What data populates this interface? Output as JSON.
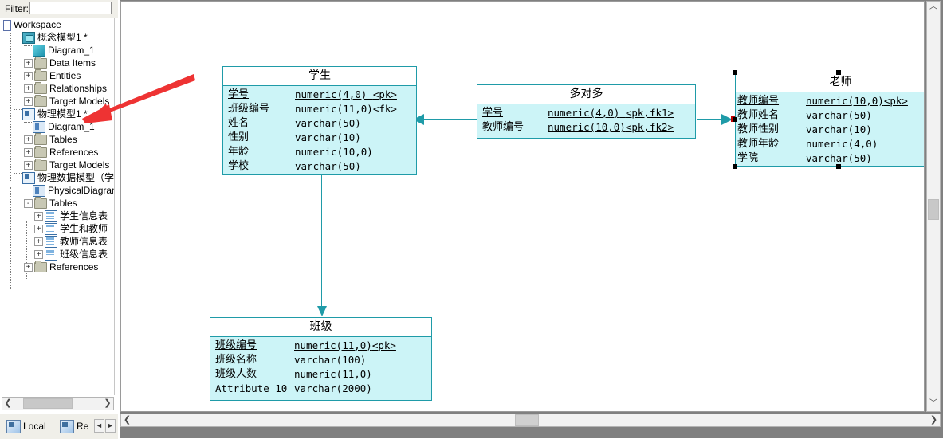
{
  "left_panel": {
    "filter": {
      "label": "Filter:",
      "value": "",
      "placeholder": ""
    },
    "tree": [
      {
        "label": "Workspace",
        "icon": "workspace-icon",
        "depth": 0,
        "expander": "",
        "selected": false
      },
      {
        "label": "概念模型1 *",
        "icon": "cdm-model-icon",
        "depth": 1,
        "expander": "",
        "selected": false
      },
      {
        "label": "Diagram_1",
        "icon": "cdm-diagram-icon",
        "depth": 2,
        "expander": "",
        "selected": false
      },
      {
        "label": "Data Items",
        "icon": "folder-icon",
        "depth": 2,
        "expander": "+",
        "selected": false
      },
      {
        "label": "Entities",
        "icon": "folder-icon",
        "depth": 2,
        "expander": "+",
        "selected": false
      },
      {
        "label": "Relationships",
        "icon": "folder-icon",
        "depth": 2,
        "expander": "+",
        "selected": false
      },
      {
        "label": "Target Models",
        "icon": "folder-icon",
        "depth": 2,
        "expander": "+",
        "selected": false
      },
      {
        "label": "物理模型1 *",
        "icon": "pdm-model-icon",
        "depth": 1,
        "expander": "",
        "selected": false
      },
      {
        "label": "Diagram_1",
        "icon": "pdm-diagram-icon",
        "depth": 2,
        "expander": "",
        "selected": false
      },
      {
        "label": "Tables",
        "icon": "folder-icon",
        "depth": 2,
        "expander": "+",
        "selected": false
      },
      {
        "label": "References",
        "icon": "folder-icon",
        "depth": 2,
        "expander": "+",
        "selected": false
      },
      {
        "label": "Target Models",
        "icon": "folder-icon",
        "depth": 2,
        "expander": "+",
        "selected": false
      },
      {
        "label": "物理数据模型（学",
        "icon": "pdm-model-icon",
        "depth": 1,
        "expander": "",
        "selected": false
      },
      {
        "label": "PhysicalDiagram",
        "icon": "pdm-diagram-icon",
        "depth": 2,
        "expander": "",
        "selected": false
      },
      {
        "label": "Tables",
        "icon": "folder-icon",
        "depth": 2,
        "expander": "-",
        "selected": false
      },
      {
        "label": "学生信息表",
        "icon": "table-icon",
        "depth": 3,
        "expander": "+",
        "selected": false
      },
      {
        "label": "学生和教师",
        "icon": "table-icon",
        "depth": 3,
        "expander": "+",
        "selected": false
      },
      {
        "label": "教师信息表",
        "icon": "table-icon",
        "depth": 3,
        "expander": "+",
        "selected": false
      },
      {
        "label": "班级信息表",
        "icon": "table-icon",
        "depth": 3,
        "expander": "+",
        "selected": false
      },
      {
        "label": "References",
        "icon": "folder-icon",
        "depth": 2,
        "expander": "+",
        "selected": false
      }
    ],
    "hscrollbar": {
      "left_arrow": "❮",
      "right_arrow": "❯"
    },
    "tabs": [
      {
        "label": "Local",
        "icon": "local-repository-icon"
      },
      {
        "label": "Re",
        "icon": "remote-repository-icon"
      }
    ],
    "tab_nav": {
      "prev": "◄",
      "next": "►"
    }
  },
  "canvas": {
    "vscrollbar": {
      "up_arrow": "︿",
      "down_arrow": "﹀"
    },
    "hscrollbar": {
      "left_arrow": "❮",
      "right_arrow": "❯"
    },
    "entities": [
      {
        "id": "student",
        "name": "学生",
        "selected": false,
        "columns": [
          {
            "name": "学号",
            "type": "numeric(4,0)",
            "key": "<pk>",
            "pk": true
          },
          {
            "name": "班级编号",
            "type": "numeric(11,0)",
            "key": "<fk>",
            "pk": false
          },
          {
            "name": "姓名",
            "type": "varchar(50)",
            "key": "",
            "pk": false
          },
          {
            "name": "性别",
            "type": "varchar(10)",
            "key": "",
            "pk": false
          },
          {
            "name": "年龄",
            "type": "numeric(10,0)",
            "key": "",
            "pk": false
          },
          {
            "name": "学校",
            "type": "varchar(50)",
            "key": "",
            "pk": false
          }
        ]
      },
      {
        "id": "many-to-many",
        "name": "多对多",
        "selected": false,
        "columns": [
          {
            "name": "学号",
            "type": "numeric(4,0)",
            "key": "<pk,fk1>",
            "pk": true
          },
          {
            "name": "教师编号",
            "type": "numeric(10,0)",
            "key": "<pk,fk2>",
            "pk": true
          }
        ]
      },
      {
        "id": "teacher",
        "name": "老师",
        "selected": true,
        "columns": [
          {
            "name": "教师编号",
            "type": "numeric(10,0)",
            "key": "<pk>",
            "pk": true
          },
          {
            "name": "教师姓名",
            "type": "varchar(50)",
            "key": "",
            "pk": false
          },
          {
            "name": "教师性别",
            "type": "varchar(10)",
            "key": "",
            "pk": false
          },
          {
            "name": "教师年龄",
            "type": "numeric(4,0)",
            "key": "",
            "pk": false
          },
          {
            "name": "学院",
            "type": "varchar(50)",
            "key": "",
            "pk": false
          }
        ]
      },
      {
        "id": "class",
        "name": "班级",
        "selected": false,
        "columns": [
          {
            "name": "班级编号",
            "type": "numeric(11,0)",
            "key": "<pk>",
            "pk": true
          },
          {
            "name": "班级名称",
            "type": "varchar(100)",
            "key": "",
            "pk": false
          },
          {
            "name": "班级人数",
            "type": "numeric(11,0)",
            "key": "",
            "pk": false
          },
          {
            "name": "Attribute_10",
            "type": "varchar(2000)",
            "key": "",
            "pk": false
          }
        ]
      }
    ]
  },
  "colors": {
    "entity_fill": "#ccf4f7",
    "entity_border": "#1f9ba8",
    "connector": "#1f9ba8",
    "annotation_arrow": "#ee3333",
    "selection_handle": "#000000"
  }
}
